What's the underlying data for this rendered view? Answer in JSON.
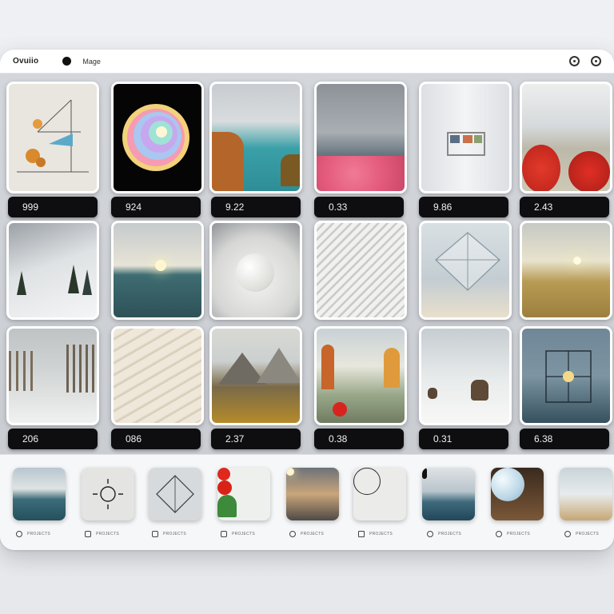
{
  "app": {
    "title": "Ovuiio",
    "nav_label": "Mage",
    "toolbar_icons": [
      "settings-ring-icon",
      "profile-ring-icon"
    ]
  },
  "gallery": {
    "cards": [
      {
        "label": "999",
        "scene": "geometric-sketch"
      },
      {
        "label": "924",
        "scene": "rainbow-swirl"
      },
      {
        "label": "9.22",
        "scene": "turquoise-lake"
      },
      {
        "label": "0.33",
        "scene": "pink-shore"
      },
      {
        "label": "9.86",
        "scene": "white-room"
      },
      {
        "label": "2.43",
        "scene": "red-bush-valley"
      },
      {
        "label": "",
        "scene": "snowy-mountain"
      },
      {
        "label": "",
        "scene": "lake-boats"
      },
      {
        "label": "",
        "scene": "white-sphere-spiral"
      },
      {
        "label": "",
        "scene": "white-waves"
      },
      {
        "label": "",
        "scene": "glass-cube"
      },
      {
        "label": "",
        "scene": "golden-meadow"
      },
      {
        "label": "206",
        "scene": "snowy-forest"
      },
      {
        "label": "086",
        "scene": "cream-layers"
      },
      {
        "label": "2.37",
        "scene": "mountain-valley"
      },
      {
        "label": "0.38",
        "scene": "autumn-field"
      },
      {
        "label": "0.31",
        "scene": "snow-bears"
      },
      {
        "label": "6.38",
        "scene": "sea-structure"
      }
    ]
  },
  "dock": {
    "items": [
      {
        "label": "PROJECTS",
        "thumb": "lake-landscape"
      },
      {
        "label": "PROJECTS",
        "thumb": "sun-symbol"
      },
      {
        "label": "PROJECTS",
        "thumb": "diamond-outline"
      },
      {
        "label": "PROJECTS",
        "thumb": "red-flowers"
      },
      {
        "label": "PROJECTS",
        "thumb": "sunset-sea"
      },
      {
        "label": "PROJECTS",
        "thumb": "circle-outline"
      },
      {
        "label": "PROJECTS",
        "thumb": "person-in-water"
      },
      {
        "label": "PROJECTS",
        "thumb": "pearl-sphere"
      },
      {
        "label": "PROJECTS",
        "thumb": "foggy-islands"
      }
    ]
  },
  "colors": {
    "pill_bg": "#0e0e10",
    "panel_bg": "#c9ccd1",
    "card_border": "#ffffff"
  }
}
